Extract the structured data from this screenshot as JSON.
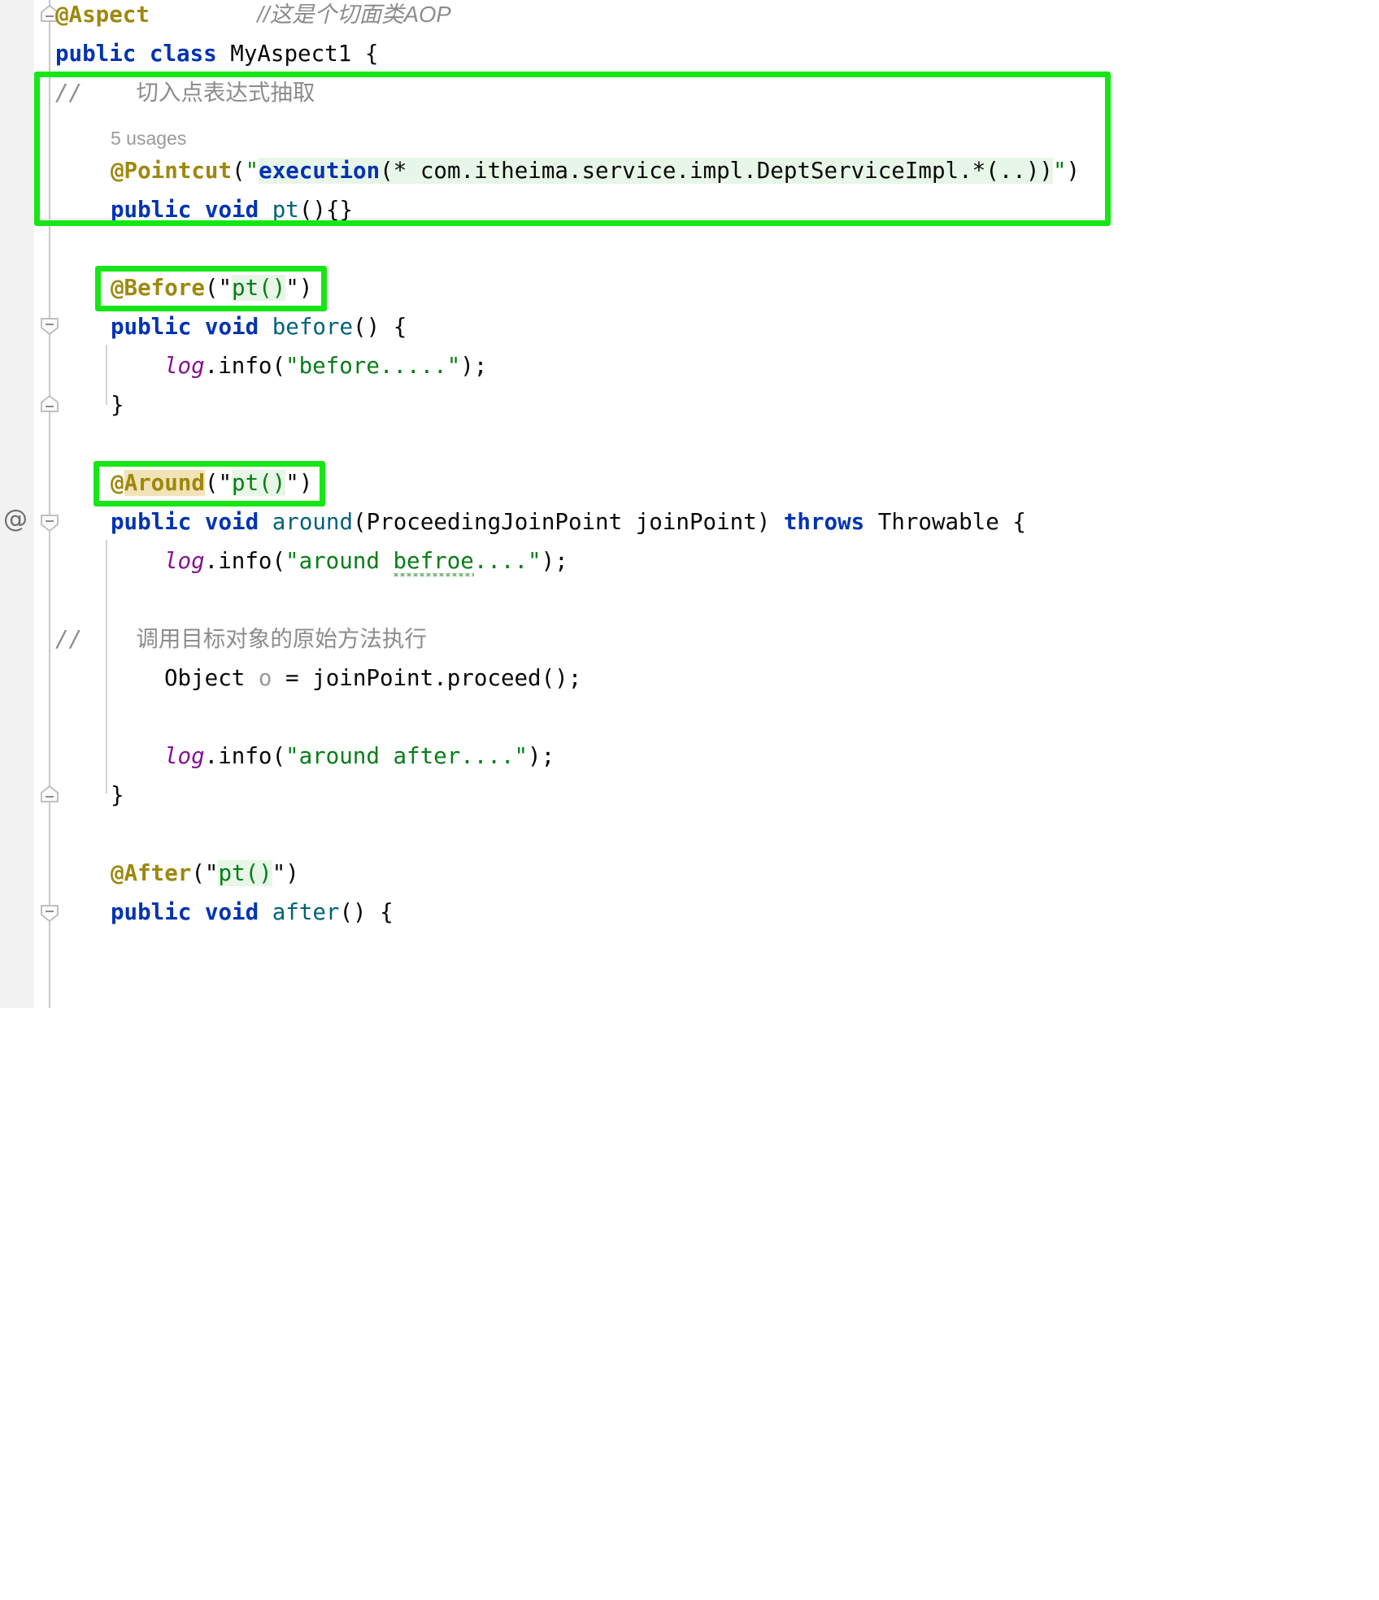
{
  "editor": {
    "language": "java",
    "class_name": "MyAspect1",
    "colors": {
      "background": "#ffffff",
      "gutter": "#f2f2f2",
      "keyword": "#0033b3",
      "annotation": "#9e880d",
      "string": "#067d17",
      "method": "#00627a",
      "field": "#871094",
      "comment": "#8c8c8c",
      "marker_green": "#16e616",
      "search_highlight": "#e7f6e7",
      "identifier_highlight": "#f2e2b8",
      "typo_squiggle": "#77b377"
    }
  },
  "code": {
    "line1": {
      "annotation": "@Aspect",
      "gap": "        ",
      "comment": "//这是个切面类AOP"
    },
    "line2": {
      "kw_public": "public",
      "kw_class": "class",
      "name": "MyAspect1",
      "brace": "{"
    },
    "line3": {
      "slashes": "//",
      "indent": "    ",
      "comment": "切入点表达式抽取"
    },
    "line4": {
      "usages": "5 usages"
    },
    "line5": {
      "annotation": "@Pointcut",
      "open": "(",
      "quote": "\"",
      "expr_execution": "execution",
      "expr_rest": "(* com.itheima.service.impl.DeptServiceImpl.*(..))",
      "close": ")"
    },
    "line6": {
      "kw_public": "public",
      "kw_void": "void",
      "method": "pt",
      "tail": "(){}"
    },
    "line7": {
      "annotation": "@Before",
      "open": "(\"",
      "arg": "pt()",
      "close": "\")"
    },
    "line8": {
      "kw_public": "public",
      "kw_void": "void",
      "method": "before",
      "tail": "() {"
    },
    "line9": {
      "field": "log",
      "call": ".info(",
      "string": "\"before.....\"",
      "tail": ");"
    },
    "line10": {
      "brace": "}"
    },
    "line11": {
      "annotation_at": "@",
      "annotation_name": "Around",
      "open": "(\"",
      "arg": "pt()",
      "close": "\")"
    },
    "line12": {
      "kw_public": "public",
      "kw_void": "void",
      "method": "around",
      "params": "(ProceedingJoinPoint joinPoint)",
      "kw_throws": "throws",
      "type": "Throwable",
      "brace": "{"
    },
    "line13": {
      "field": "log",
      "call": ".info(",
      "str_open": "\"around ",
      "typo": "befroe",
      "str_close": "....\"",
      "tail": ");"
    },
    "line14": {
      "slashes": "//",
      "indent": "    ",
      "comment": "调用目标对象的原始方法执行"
    },
    "line15": {
      "type": "Object",
      "var": "o",
      "eq": "=",
      "expr": "joinPoint.proceed();"
    },
    "line16": {
      "field": "log",
      "call": ".info(",
      "string": "\"around after....\"",
      "tail": ");"
    },
    "line17": {
      "brace": "}"
    },
    "line18": {
      "annotation": "@After",
      "open": "(\"",
      "arg": "pt()",
      "close": "\")"
    },
    "line19": {
      "kw_public": "public",
      "kw_void": "void",
      "method": "after",
      "tail": "() {"
    }
  },
  "gutter": {
    "annotation_glyph": "@",
    "fold_icon": "fold-minus-icon"
  },
  "markers": {
    "pointcut_box_label": "pointcut-declaration-highlight",
    "before_box_label": "before-annotation-highlight",
    "around_box_label": "around-annotation-highlight"
  }
}
